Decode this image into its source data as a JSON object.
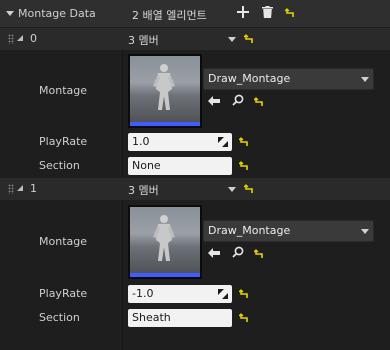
{
  "header": {
    "label": "Montage Data",
    "count": "2 배열 엘리먼트",
    "add_icon": "plus-icon",
    "delete_icon": "trash-icon",
    "reset_icon": "reset-arrow-icon"
  },
  "elements": [
    {
      "index": "0",
      "members": "3 멤버",
      "montage_label": "Montage",
      "montage_value": "Draw_Montage",
      "playrate_label": "PlayRate",
      "playrate_value": "1.0",
      "section_label": "Section",
      "section_value": "None"
    },
    {
      "index": "1",
      "members": "3 멤버",
      "montage_label": "Montage",
      "montage_value": "Draw_Montage",
      "playrate_label": "PlayRate",
      "playrate_value": "-1.0",
      "section_label": "Section",
      "section_value": "Sheath"
    }
  ],
  "colors": {
    "reset_yellow": "#e8d400",
    "thumb_accent": "#3f5cff"
  }
}
